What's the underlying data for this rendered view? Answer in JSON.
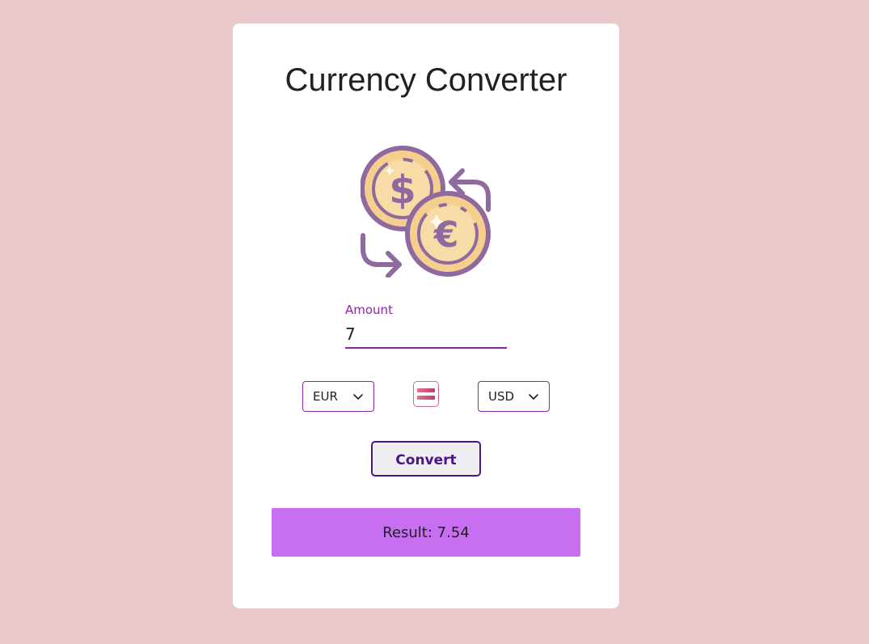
{
  "title": "Currency Converter",
  "hero_icon": "currency-exchange-icon",
  "amount": {
    "label": "Amount",
    "value": "7"
  },
  "from_currency": {
    "selected": "EUR"
  },
  "to_currency": {
    "selected": "USD"
  },
  "swap_icon": "swap-icon",
  "convert_button": {
    "label": "Convert"
  },
  "result": {
    "text": "Result: 7.54"
  },
  "colors": {
    "background": "#e8c8cb",
    "card": "#ffffff",
    "accent": "#8e24aa",
    "button_border": "#4a148c",
    "result_bg": "#c76ff0"
  }
}
